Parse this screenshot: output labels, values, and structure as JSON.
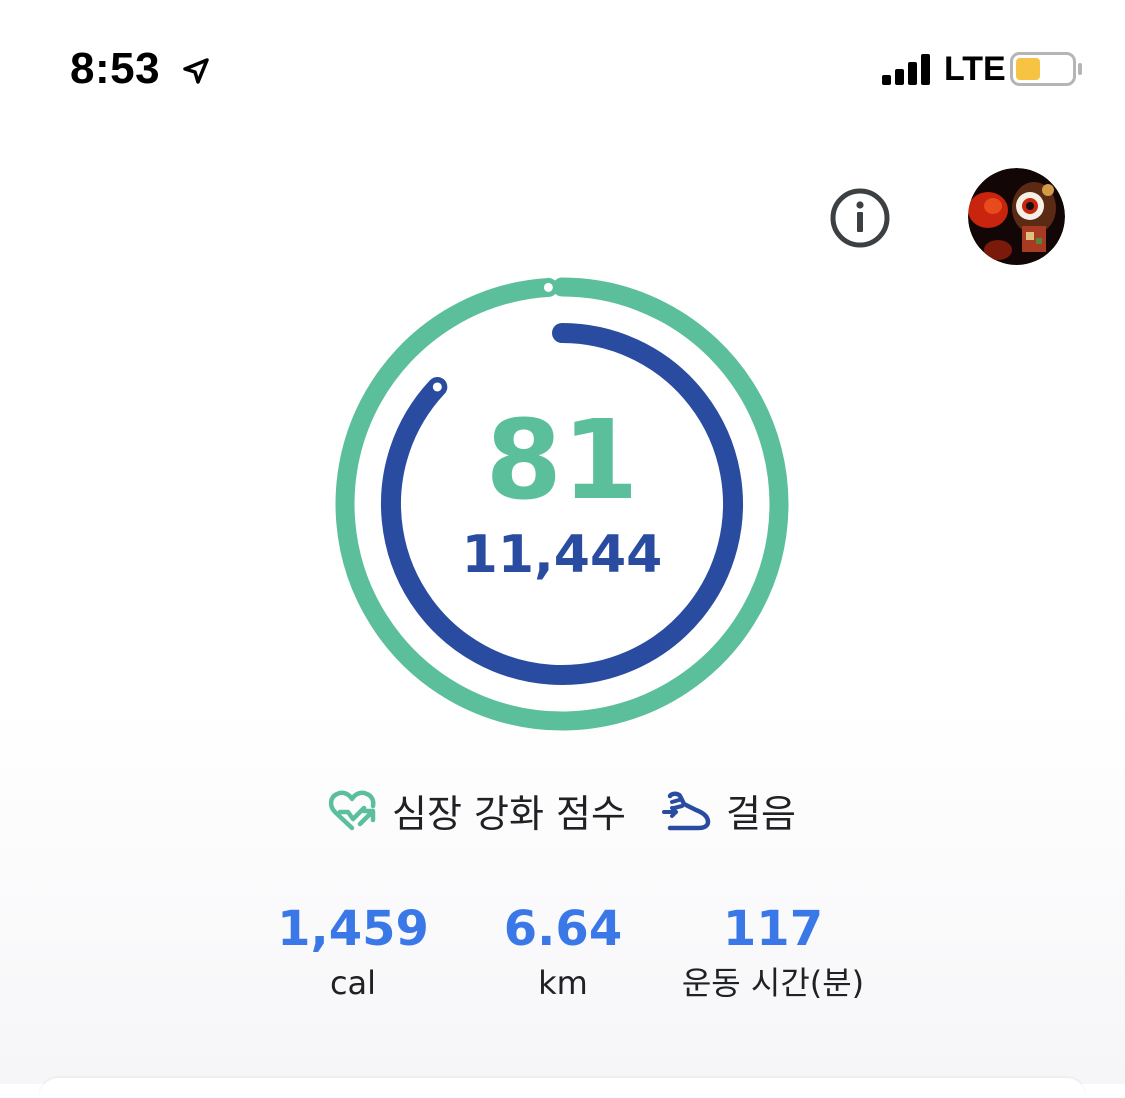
{
  "status_bar": {
    "time": "8:53",
    "network": "LTE",
    "battery_color": "#f6c342"
  },
  "header": {
    "info_icon": "info-icon",
    "avatar_icon": "profile-avatar"
  },
  "rings": {
    "heart_points_progress": 0.99,
    "steps_progress": 0.87,
    "heart_color": "#5cbf9b",
    "steps_color": "#2a4ca0"
  },
  "summary": {
    "heart_points": "81",
    "steps": "11,444"
  },
  "legend": {
    "heart_points_label": "심장 강화 점수",
    "heart_points_icon": "heart-arrow-icon",
    "steps_label": "걸음",
    "steps_icon": "shoe-icon"
  },
  "stats": [
    {
      "value": "1,459",
      "unit": "cal"
    },
    {
      "value": "6.64",
      "unit": "km"
    },
    {
      "value": "117",
      "unit": "운동 시간(분)"
    }
  ],
  "colors": {
    "stat_value": "#3b78e7",
    "text": "#202124"
  }
}
